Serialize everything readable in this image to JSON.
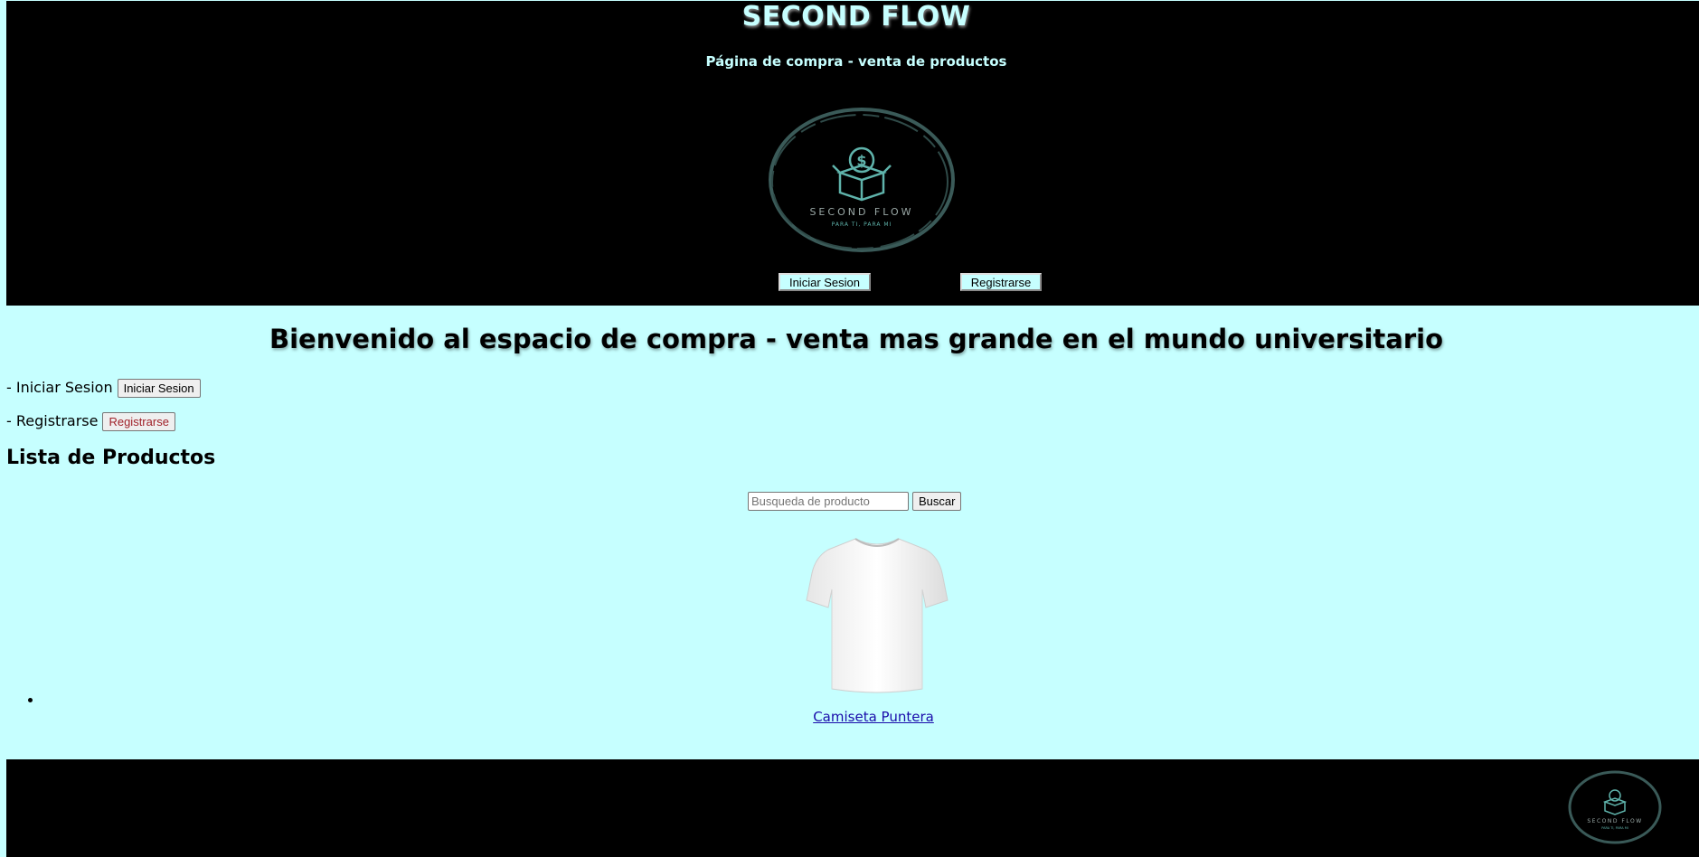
{
  "header": {
    "brand": "SECOND FLOW",
    "subtitle": "Página de compra - venta de productos",
    "logo": {
      "name": "SECOND FLOW",
      "tagline": "PARA TI, PARA MI",
      "icon": "box-dollar-icon"
    },
    "login_button": "Iniciar Sesion",
    "register_button": "Registrarse"
  },
  "main": {
    "welcome": "Bienvenido al espacio de compra - venta mas grande en el mundo universitario",
    "login_line": {
      "label": "- Iniciar Sesion",
      "button": "Iniciar Sesion"
    },
    "register_line": {
      "label": "- Registrarse",
      "button": "Registrarse"
    },
    "list_title": "Lista de Productos",
    "search": {
      "placeholder": "Busqueda de producto",
      "value": "",
      "button": "Buscar"
    },
    "products": [
      {
        "name": "Camiseta Puntera",
        "image": "white-tshirt"
      }
    ]
  },
  "footer": {
    "logo": {
      "name": "SECOND FLOW",
      "tagline": "PARA TI, PARA MI"
    }
  },
  "colors": {
    "background": "#c6ffff",
    "header_bg": "#000000",
    "brand_text": "#c6ffff",
    "logo_accent": "#3a5a58",
    "link": "#1a0dab"
  }
}
